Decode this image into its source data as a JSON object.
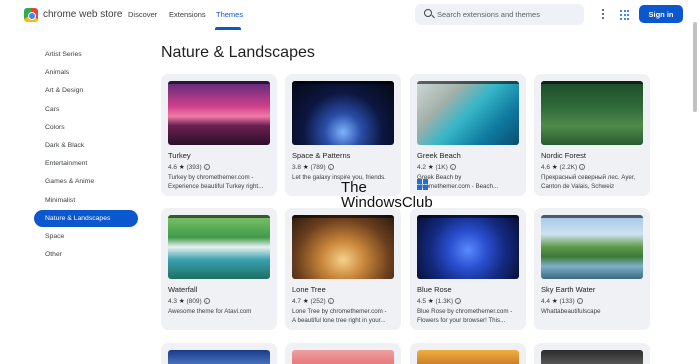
{
  "header": {
    "brand": "chrome web store",
    "tabs": [
      {
        "label": "Discover",
        "active": false
      },
      {
        "label": "Extensions",
        "active": false
      },
      {
        "label": "Themes",
        "active": true
      }
    ],
    "search_placeholder": "Search extensions and themes",
    "signin_label": "Sign in",
    "icons": [
      "chrome-web-store-logo",
      "search-icon",
      "more-vert-icon",
      "apps-grid-icon"
    ],
    "accent_color": "#0b57d0"
  },
  "sidebar": {
    "items": [
      {
        "label": "Artist Series",
        "active": false
      },
      {
        "label": "Animals",
        "active": false
      },
      {
        "label": "Art & Design",
        "active": false
      },
      {
        "label": "Cars",
        "active": false
      },
      {
        "label": "Colors",
        "active": false
      },
      {
        "label": "Dark & Black",
        "active": false
      },
      {
        "label": "Entertainment",
        "active": false
      },
      {
        "label": "Games & Anime",
        "active": false
      },
      {
        "label": "Minimalist",
        "active": false
      },
      {
        "label": "Nature & Landscapes",
        "active": true
      },
      {
        "label": "Space",
        "active": false
      },
      {
        "label": "Other",
        "active": false
      }
    ]
  },
  "main": {
    "title": "Nature & Landscapes",
    "cards": [
      {
        "title": "Turkey",
        "rating": "4.6",
        "count": "(393)",
        "desc1": "Turkey by chromethemer.com -",
        "desc2": "Experience beautiful Turkey right..."
      },
      {
        "title": "Space & Patterns",
        "rating": "3.8",
        "count": "(789)",
        "desc1": "Let the galaxy inspire you, friends.",
        "desc2": ""
      },
      {
        "title": "Greek Beach",
        "rating": "4.2",
        "count": "(1K)",
        "desc1": "Greek Beach by",
        "desc2": "chromethemer.com - Beach..."
      },
      {
        "title": "Nordic Forest",
        "rating": "4.6",
        "count": "(2.2K)",
        "desc1": "Прекрасный северный лес. Ayer,",
        "desc2": "Canton de Valais, Schweiz"
      },
      {
        "title": "Waterfall",
        "rating": "4.3",
        "count": "(809)",
        "desc1": "Awesome theme for Atavi.com",
        "desc2": ""
      },
      {
        "title": "Lone Tree",
        "rating": "4.7",
        "count": "(252)",
        "desc1": "Lone Tree by chromethemer.com -",
        "desc2": "A beautiful lone tree right in your..."
      },
      {
        "title": "Blue Rose",
        "rating": "4.5",
        "count": "(1.3K)",
        "desc1": "Blue Rose by chromethemer.com -",
        "desc2": "Flowers for your browser! This..."
      },
      {
        "title": "Sky Earth Water",
        "rating": "4.4",
        "count": "(133)",
        "desc1": "Whattabeautifulscape",
        "desc2": ""
      }
    ],
    "star_glyph": "★",
    "info_glyph": "i"
  },
  "watermark": {
    "line1": "The",
    "line2": "WindowsClub"
  }
}
